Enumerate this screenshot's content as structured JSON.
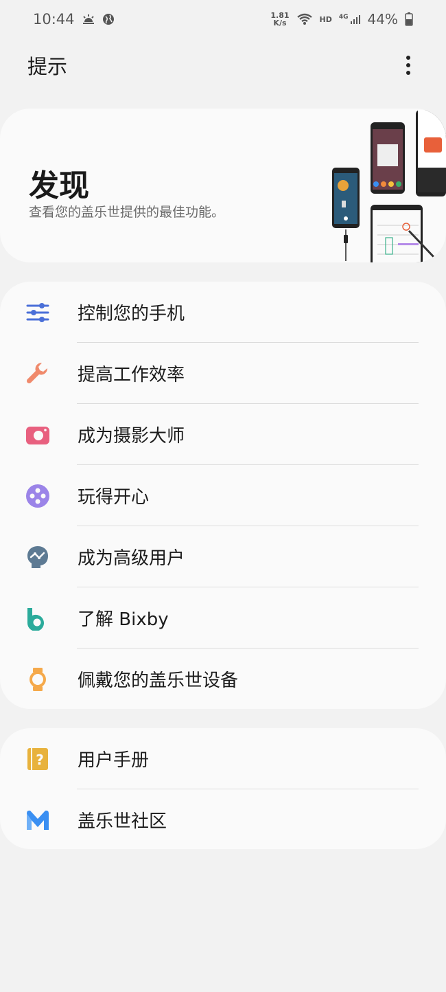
{
  "status_bar": {
    "time": "10:44",
    "speed_value": "1.81",
    "speed_unit": "K/s",
    "network_hd": "HD",
    "network_type": "4G",
    "battery": "44%"
  },
  "app_bar": {
    "title": "提示"
  },
  "discover": {
    "title": "发现",
    "subtitle": "查看您的盖乐世提供的最佳功能。"
  },
  "main_list": [
    {
      "label": "控制您的手机",
      "icon": "sliders-icon",
      "color": "#4a6fd8"
    },
    {
      "label": "提高工作效率",
      "icon": "wrench-icon",
      "color": "#f08a6c"
    },
    {
      "label": "成为摄影大师",
      "icon": "camera-icon",
      "color": "#e8607f"
    },
    {
      "label": "玩得开心",
      "icon": "game-icon",
      "color": "#9b84e8"
    },
    {
      "label": "成为高级用户",
      "icon": "brain-icon",
      "color": "#5d7a93"
    },
    {
      "label": "了解 Bixby",
      "icon": "bixby-icon",
      "color": "#2bab9b"
    },
    {
      "label": "佩戴您的盖乐世设备",
      "icon": "watch-icon",
      "color": "#f5a94a"
    }
  ],
  "secondary_list": [
    {
      "label": "用户手册",
      "icon": "manual-icon",
      "color": "#e8b23c"
    },
    {
      "label": "盖乐世社区",
      "icon": "community-icon",
      "color": "#3a8ff2"
    }
  ]
}
